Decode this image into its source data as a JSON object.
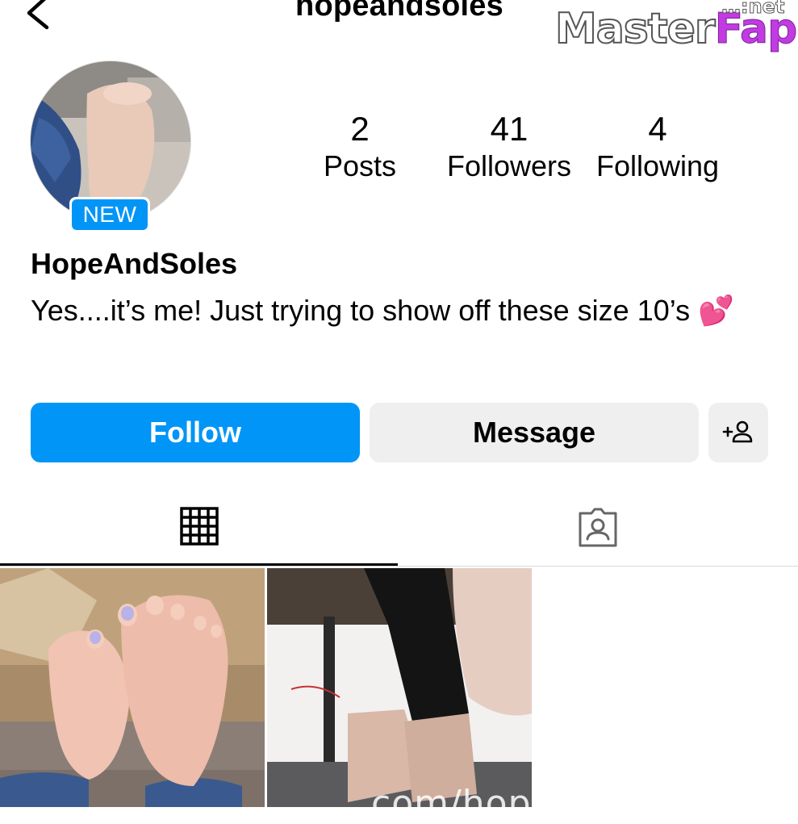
{
  "header": {
    "username": "hopeandsoles",
    "back_icon": "chevron-left-icon"
  },
  "watermark": {
    "master": "Master",
    "fap": "Fap",
    "net": "…:net",
    "bottom_text": "com/hopeandlik"
  },
  "profile": {
    "avatar_badge": "NEW",
    "display_name": "HopeAndSoles",
    "bio": "Yes....it’s me! Just trying to show off these size 10’s 💕"
  },
  "stats": {
    "posts": {
      "value": "2",
      "label": "Posts"
    },
    "followers": {
      "value": "41",
      "label": "Followers"
    },
    "following": {
      "value": "4",
      "label": "Following"
    }
  },
  "actions": {
    "follow_label": "Follow",
    "message_label": "Message",
    "add_user_icon": "add-person-icon"
  },
  "tabs": [
    {
      "icon": "grid-icon",
      "active": true
    },
    {
      "icon": "tagged-person-icon",
      "active": false
    }
  ],
  "colors": {
    "accent": "#0095f6",
    "button_secondary": "#efefef",
    "divider": "#dbdbdb"
  }
}
